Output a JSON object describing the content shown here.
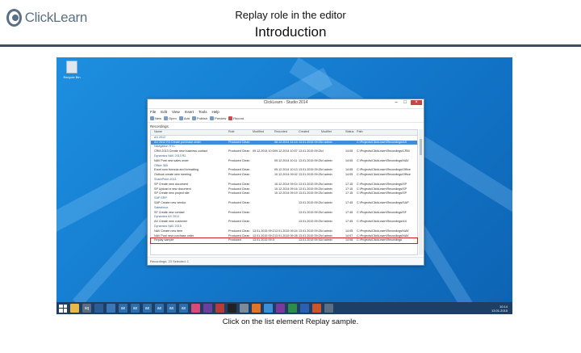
{
  "logo": {
    "text": "ClickLearn"
  },
  "slide": {
    "title": "Replay role in the editor",
    "subtitle": "Introduction"
  },
  "desktop": {
    "recycle_bin_label": "Recycle Bin"
  },
  "window": {
    "title": "ClickLearn - Studio 2014",
    "menu": [
      "File",
      "Edit",
      "View",
      "Insert",
      "Tools",
      "Help"
    ],
    "toolbar": [
      "New",
      "Open",
      "Add",
      "Publish",
      "Preview",
      "Record"
    ],
    "section": "Recordings",
    "columns": [
      "Name",
      "Role",
      "Modified",
      "Recorded",
      "Created",
      "Modifier",
      "Status",
      "Path"
    ],
    "rows": [
      {
        "kind": "group",
        "cells": [
          "AX 2012",
          "",
          "",
          "",
          "",
          "",
          "",
          ""
        ]
      },
      {
        "kind": "sel",
        "cells": [
          "AX 2012 R3 Create purchase order",
          "Produced Clean",
          "",
          "08.12.2014 14:14",
          "13.01.2015 09:25",
          "cl admin",
          "",
          "C:\\Projects\\ClickLearn\\Recordings\\AX"
        ]
      },
      {
        "kind": "group",
        "cells": [
          "Navigation RTC",
          "",
          "",
          "",
          "",
          "",
          "",
          ""
        ]
      },
      {
        "kind": "row",
        "cells": [
          "CRM 2013 Create new business contact",
          "Produced Clean",
          "09.12.2014 10:05",
          "09.12.2014 10:07",
          "13.01.2015 09:25",
          "cl",
          "14:05",
          "C:\\Projects\\ClickLearn\\Recordings\\CRM"
        ]
      },
      {
        "kind": "group",
        "cells": [
          "Dynamics NAV 2013 R2",
          "",
          "",
          "",
          "",
          "",
          "",
          ""
        ]
      },
      {
        "kind": "row",
        "cells": [
          "NAV Post new sales order",
          "Produced Clean",
          "",
          "09.12.2014 10:11",
          "13.01.2015 09:25",
          "cl admin",
          "14:05",
          "C:\\Projects\\ClickLearn\\Recordings\\NAV"
        ]
      },
      {
        "kind": "group",
        "cells": [
          "Office 365",
          "",
          "",
          "",
          "",
          "",
          "",
          ""
        ]
      },
      {
        "kind": "row",
        "cells": [
          "Excel sum formula and formatting",
          "Produced Clean",
          "",
          "09.12.2014 10:13",
          "13.01.2015 09:25",
          "cl admin",
          "14:05",
          "C:\\Projects\\ClickLearn\\Recordings\\Office"
        ]
      },
      {
        "kind": "row",
        "cells": [
          "Outlook create new meeting",
          "Produced Clean",
          "",
          "10.12.2014 09:02",
          "13.01.2015 09:25",
          "cl admin",
          "14:05",
          "C:\\Projects\\ClickLearn\\Recordings\\Office"
        ]
      },
      {
        "kind": "group",
        "cells": [
          "SharePoint 2013",
          "",
          "",
          "",
          "",
          "",
          "",
          ""
        ]
      },
      {
        "kind": "row",
        "cells": [
          "SP Create new document",
          "Produced Clean",
          "",
          "10.12.2014 09:14",
          "13.01.2015 09:25",
          "cl admin",
          "17:15",
          "C:\\Projects\\ClickLearn\\Recordings\\SP"
        ]
      },
      {
        "kind": "row",
        "cells": [
          "SP Upload a new document",
          "Produced Clean",
          "",
          "10.12.2014 09:16",
          "13.01.2015 09:25",
          "cl admin",
          "17:15",
          "C:\\Projects\\ClickLearn\\Recordings\\SP"
        ]
      },
      {
        "kind": "row",
        "cells": [
          "SP Create new project site",
          "Produced Clean",
          "",
          "10.12.2014 09:19",
          "13.01.2015 09:25",
          "cl admin",
          "17:15",
          "C:\\Projects\\ClickLearn\\Recordings\\SP"
        ]
      },
      {
        "kind": "group",
        "cells": [
          "SAP ERP",
          "",
          "",
          "",
          "",
          "",
          "",
          ""
        ]
      },
      {
        "kind": "row",
        "cells": [
          "SAP Create new vendor",
          "Produced Clean",
          "",
          "",
          "13.01.2015 09:25",
          "cl admin",
          "17:45",
          "C:\\Projects\\ClickLearn\\Recordings\\SAP"
        ]
      },
      {
        "kind": "group",
        "cells": [
          "Salesforce",
          "",
          "",
          "",
          "",
          "",
          "",
          ""
        ]
      },
      {
        "kind": "row",
        "cells": [
          "SF Create new contact",
          "Produced Clean",
          "",
          "",
          "13.01.2015 09:25",
          "cl admin",
          "17:45",
          "C:\\Projects\\ClickLearn\\Recordings\\SF"
        ]
      },
      {
        "kind": "group",
        "cells": [
          "Dynamics AX 2012",
          "",
          "",
          "",
          "",
          "",
          "",
          ""
        ]
      },
      {
        "kind": "row",
        "cells": [
          "AX Create new customer",
          "Produced Clean",
          "",
          "",
          "13.01.2015 09:25",
          "cl admin",
          "17:45",
          "C:\\Projects\\ClickLearn\\Recordings\\AX"
        ]
      },
      {
        "kind": "group",
        "cells": [
          "Dynamics NAV 2015",
          "",
          "",
          "",
          "",
          "",
          "",
          ""
        ]
      },
      {
        "kind": "row",
        "cells": [
          "NAV Create new item",
          "Produced Clean",
          "13.01.2015 09:23",
          "13.01.2015 09:24",
          "13.01.2015 09:25",
          "cl admin",
          "14:05",
          "C:\\Projects\\ClickLearn\\Recordings\\NAV"
        ]
      },
      {
        "kind": "row",
        "cells": [
          "NAV Post new purchase order",
          "Produced Clean",
          "13.01.2015 09:27",
          "13.01.2015 09:28",
          "13.01.2015 09:29",
          "cl admin",
          "14:07",
          "C:\\Projects\\ClickLearn\\Recordings\\NAV"
        ]
      },
      {
        "kind": "highlight",
        "cells": [
          "Replay sample",
          "Produced",
          "13.01.2015 09:30",
          "",
          "13.01.2015 09:30",
          "cl admin",
          "14:08",
          "C:\\Projects\\ClickLearn\\Recordings"
        ]
      }
    ],
    "status": "Recordings: 23 Selected: 1"
  },
  "taskbar": {
    "clock_time": "10:14",
    "clock_date": "13.01.2015"
  },
  "caption": "Click on the list element Replay sample."
}
